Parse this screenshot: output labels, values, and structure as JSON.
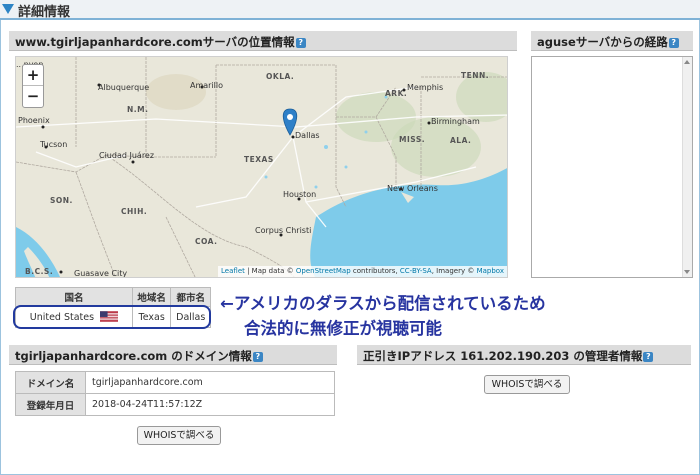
{
  "header": {
    "title": "詳細情報"
  },
  "location_section": {
    "title": "www.tgirljapanhardcore.comサーバの位置情報",
    "help": "?",
    "map": {
      "zoom_in": "+",
      "zoom_out": "−",
      "labels": {
        "canyon": "...nyon",
        "albuquerque": "Albuquerque",
        "amarillo": "Amarillo",
        "okla": "OKLA.",
        "memphis": "Memphis",
        "tenn": "TENN.",
        "ark": "ARK.",
        "nm": "N.M.",
        "phoenix": "Phoenix",
        "dallas": "Dallas",
        "birmingham": "Birmingham",
        "miss": "MISS.",
        "ala": "ALA.",
        "tucson": "Tucson",
        "juarez": "Ciudad Juárez",
        "texas": "TEXAS",
        "son": "SON.",
        "chih": "CHIH.",
        "houston": "Houston",
        "new_orleans": "New Orleans",
        "coa": "COA.",
        "corpus": "Corpus Christi",
        "bcs": "B.C.S.",
        "guasave": "Guasave City"
      },
      "attribution": {
        "leaflet": "Leaflet",
        "sep1": " | Map data © ",
        "osm": "OpenStreetMap",
        "sep2": " contributors, ",
        "license": "CC-BY-SA",
        "sep3": ", Imagery © ",
        "mapbox": "Mapbox"
      }
    }
  },
  "route_section": {
    "title": "aguseサーバからの経路",
    "help": "?"
  },
  "location_table": {
    "headers": [
      "国名",
      "地域名",
      "都市名"
    ],
    "country": "United States",
    "region": "Texas",
    "city": "Dallas"
  },
  "annotation": {
    "line1": "←アメリカのダラスから配信されているため",
    "line2": "合法的に無修正が視聴可能"
  },
  "domain_section": {
    "title": "tgirljapanhardcore.com のドメイン情報",
    "help": "?",
    "rows": [
      {
        "label": "ドメイン名",
        "value": "tgirljapanhardcore.com"
      },
      {
        "label": "登録年月日",
        "value": "2018-04-24T11:57:12Z"
      }
    ],
    "whois_button": "WHOISで調べる"
  },
  "ip_section": {
    "title": "正引きIPアドレス 161.202.190.203 の管理者情報",
    "help": "?",
    "whois_button": "WHOISで調べる"
  },
  "colors": {
    "accent": "#2d84c5",
    "annotation": "#2734a0",
    "water": "#7ecbea",
    "marker": "#2e80c8"
  }
}
